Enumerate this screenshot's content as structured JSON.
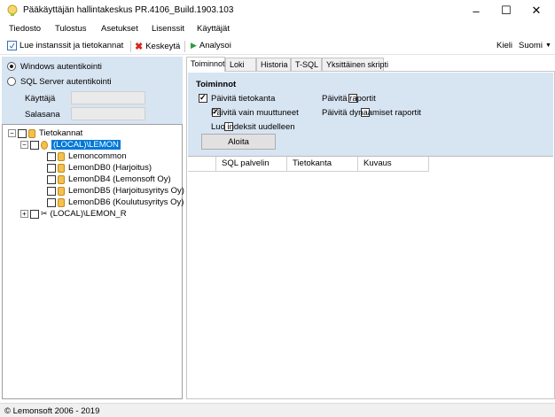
{
  "window": {
    "title": "Pääkäyttäjän hallintakeskus PR.4106_Build.1903.103"
  },
  "menu": [
    "Tiedosto",
    "Tulostus",
    "Asetukset",
    "Lisenssit",
    "Käyttäjät"
  ],
  "toolbar": {
    "load": "Lue instanssit ja tietokannat",
    "cancel": "Keskeytä",
    "analyze": "Analysoi",
    "language_label": "Kieli",
    "language_value": "Suomi"
  },
  "auth": {
    "windows": "Windows autentikointi",
    "sql": "SQL Server autentikointi",
    "user_label": "Käyttäjä",
    "password_label": "Salasana",
    "user_value": "",
    "password_value": ""
  },
  "tree": {
    "root": "Tietokannat",
    "instance1": "(LOCAL)\\LEMON",
    "dbs": [
      "Lemoncommon",
      "LemonDB0 (Harjoitus)",
      "LemonDB4 (Lemonsoft Oy)",
      "LemonDB5 (Harjoitusyritys Oy)",
      "LemonDB6 (Koulutusyritys Oy)"
    ],
    "instance2": "(LOCAL)\\LEMON_R"
  },
  "tabs": [
    "Toiminnot",
    "Loki",
    "Historia",
    "T-SQL",
    "Yksittäinen skripti"
  ],
  "actions": {
    "heading": "Toiminnot",
    "update_db": "Päivitä tietokanta",
    "update_changed": "Päivitä vain muuttuneet",
    "rebuild_indexes": "Luo indeksit uudelleen",
    "update_reports": "Päivitä raportit",
    "update_dynamic_reports": "Päivitä dynaamiset raportit",
    "start": "Aloita",
    "checked": {
      "update_db": true,
      "update_changed": true,
      "rebuild_indexes": false,
      "update_reports": false,
      "update_dynamic_reports": false
    }
  },
  "grid": {
    "columns": [
      "SQL palvelin",
      "Tietokanta",
      "Kuvaus"
    ]
  },
  "status": "© Lemonsoft 2006 - 2019"
}
